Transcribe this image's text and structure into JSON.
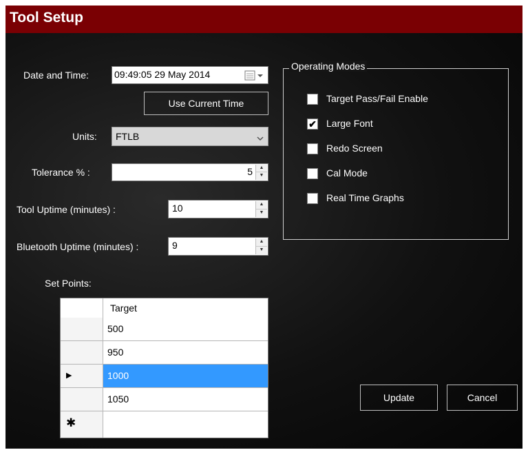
{
  "window": {
    "title": "Tool Setup"
  },
  "form": {
    "date_label": "Date and Time:",
    "date_value": "09:49:05 29 May 2014",
    "use_current_time_label": "Use Current Time",
    "units_label": "Units:",
    "units_value": "FTLB",
    "tolerance_label": "Tolerance % :",
    "tolerance_value": "5",
    "tool_uptime_label": "Tool Uptime (minutes) :",
    "tool_uptime_value": "10",
    "bt_uptime_label": "Bluetooth Uptime (minutes) :",
    "bt_uptime_value": "9",
    "setpoints_label": "Set Points:"
  },
  "operating_modes": {
    "title": "Operating Modes",
    "items": [
      {
        "label": "Target Pass/Fail Enable",
        "checked": false,
        "mark": ""
      },
      {
        "label": "Large Font",
        "checked": true,
        "mark": "✔"
      },
      {
        "label": "Redo Screen",
        "checked": false,
        "mark": ""
      },
      {
        "label": "Cal Mode",
        "checked": false,
        "mark": ""
      },
      {
        "label": "Real Time Graphs",
        "checked": false,
        "mark": ""
      }
    ]
  },
  "setpoints": {
    "header": "Target",
    "rows": [
      "500",
      "950",
      "1000",
      "1050",
      ""
    ],
    "selected_row_index": 2,
    "new_row_marker": "✱",
    "current_row_marker": "▶"
  },
  "buttons": {
    "update": "Update",
    "cancel": "Cancel"
  },
  "colors": {
    "titlebar": "#7a0003",
    "selection": "#3399ff",
    "background": "#000000"
  }
}
